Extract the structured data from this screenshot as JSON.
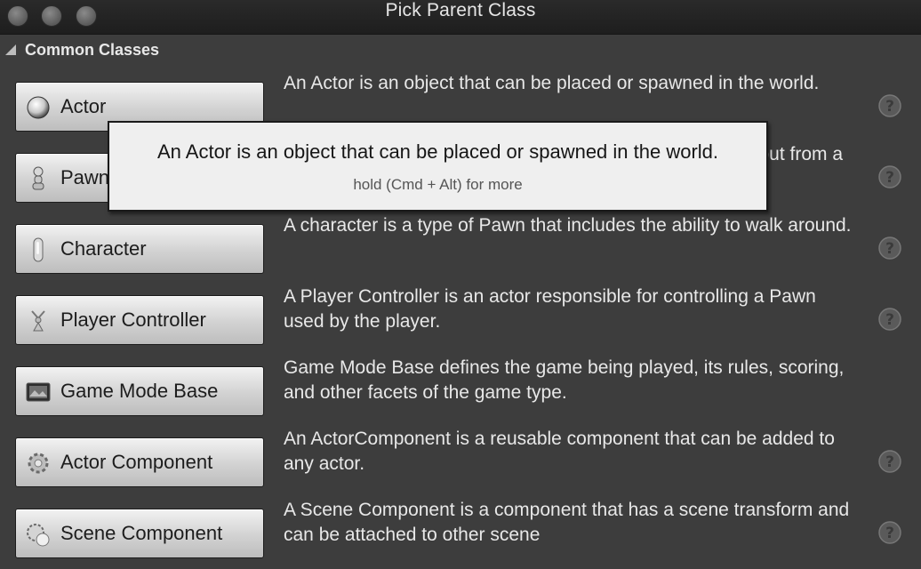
{
  "window": {
    "title": "Pick Parent Class"
  },
  "section": {
    "label": "Common Classes"
  },
  "classes": [
    {
      "label": "Actor",
      "icon": "sphere-icon",
      "description": "An Actor is an object that can be placed or spawned in the world."
    },
    {
      "label": "Pawn",
      "icon": "pawn-icon",
      "description": "A Pawn is an actor that can be 'possessed' and receive input from a controller."
    },
    {
      "label": "Character",
      "icon": "capsule-icon",
      "description": "A character is a type of Pawn that includes the ability to walk around."
    },
    {
      "label": "Player Controller",
      "icon": "controller-icon",
      "description": "A Player Controller is an actor responsible for controlling a Pawn used by the player."
    },
    {
      "label": "Game Mode Base",
      "icon": "game-mode-icon",
      "description": "Game Mode Base defines the game being played, its rules, scoring, and other facets of the game type."
    },
    {
      "label": "Actor Component",
      "icon": "gear-icon",
      "description": "An ActorComponent is a reusable component that can be added to any actor."
    },
    {
      "label": "Scene Component",
      "icon": "scene-component-icon",
      "description": "A Scene Component is a component that has a scene transform and can be attached to other scene"
    }
  ],
  "tooltip": {
    "main": "An Actor is an object that can be placed or spawned in the world.",
    "hint": "hold (Cmd + Alt) for more"
  },
  "colors": {
    "background": "#3d3d3d",
    "button_top": "#f2f2f2",
    "button_bottom": "#bdbdbd",
    "text_light": "#e8e8e8",
    "tooltip_bg": "#efefef"
  }
}
